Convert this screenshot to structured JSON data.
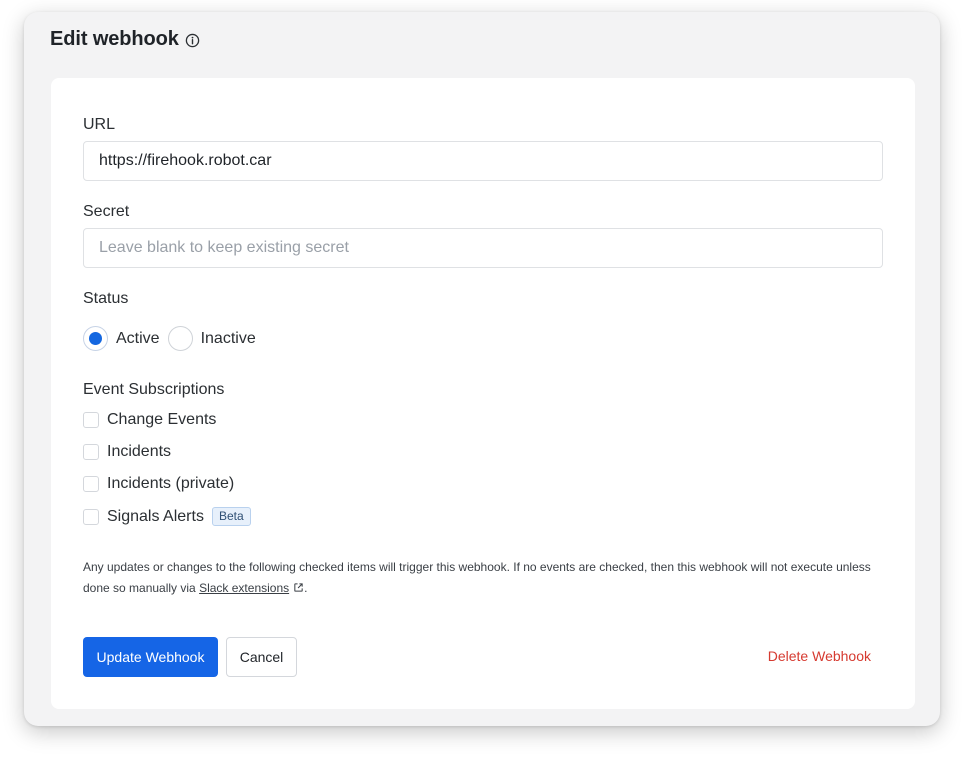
{
  "dialog": {
    "title": "Edit webhook",
    "info_icon": "info-icon"
  },
  "url": {
    "label": "URL",
    "value": "https://firehook.robot.car",
    "placeholder": ""
  },
  "secret": {
    "label": "Secret",
    "value": "",
    "placeholder": "Leave blank to keep existing secret"
  },
  "status": {
    "label": "Status",
    "options": [
      {
        "label": "Active",
        "checked": true
      },
      {
        "label": "Inactive",
        "checked": false
      }
    ]
  },
  "events": {
    "label": "Event Subscriptions",
    "items": [
      {
        "label": "Change Events",
        "checked": false
      },
      {
        "label": "Incidents",
        "checked": false
      },
      {
        "label": "Incidents (private)",
        "checked": false
      },
      {
        "label": "Signals Alerts",
        "checked": false,
        "badge": "Beta"
      }
    ]
  },
  "help": {
    "text": "Any updates or changes to the following checked items will trigger this webhook. If no events are checked, then this webhook will not execute unless done so manually via ",
    "link_text": "Slack extensions",
    "suffix": ".",
    "link_icon": "external-link-icon"
  },
  "actions": {
    "update_label": "Update Webhook",
    "cancel_label": "Cancel",
    "delete_label": "Delete Webhook"
  },
  "colors": {
    "primary": "#1565e6",
    "danger": "#d63a30",
    "badge_bg": "#e7f0fb"
  }
}
